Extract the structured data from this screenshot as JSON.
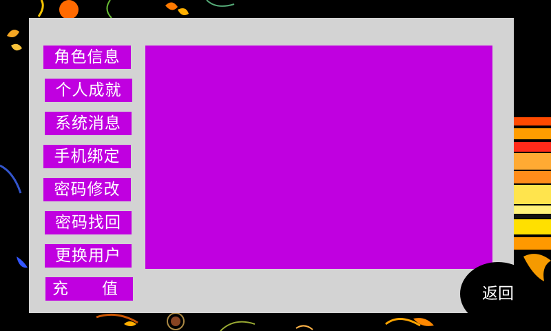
{
  "menu": {
    "items": [
      {
        "label": "角色信息"
      },
      {
        "label": "个人成就"
      },
      {
        "label": "系统消息"
      },
      {
        "label": "手机绑定"
      },
      {
        "label": "密码修改"
      },
      {
        "label": "密码找回"
      },
      {
        "label": "更换用户"
      }
    ],
    "recharge": {
      "char1": "充",
      "char2": "值"
    }
  },
  "back_button": {
    "label": "返回"
  },
  "colors": {
    "panel": "#d3d3d3",
    "accent": "#c000e0",
    "background": "#000000"
  }
}
